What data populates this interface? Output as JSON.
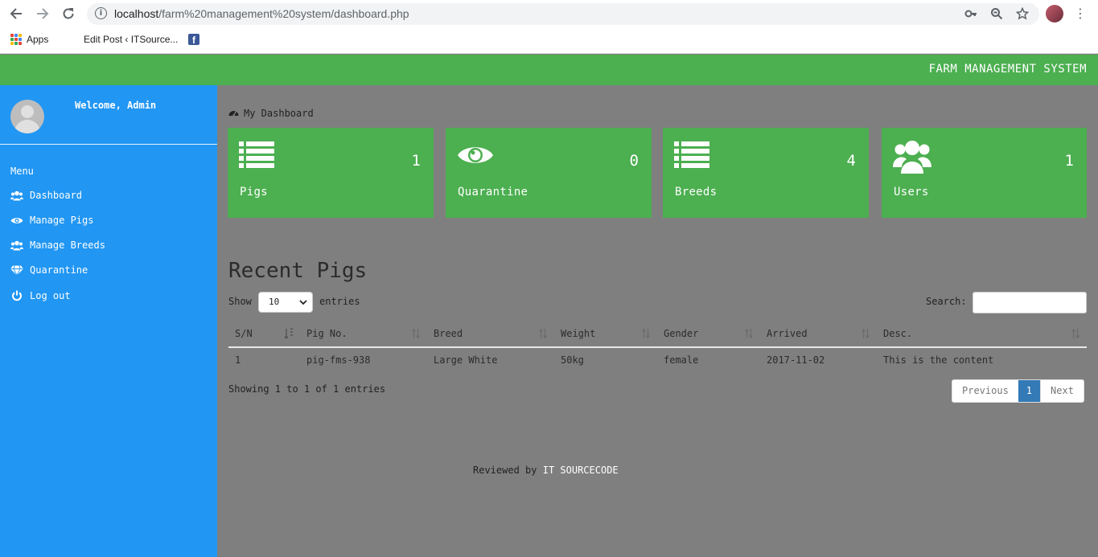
{
  "browser": {
    "url_host": "localhost",
    "url_path": "/farm%20management%20system/dashboard.php",
    "bookmarks": [
      {
        "label": "Apps",
        "icon": "apps-grid-icon"
      },
      {
        "label": "Edit Post ‹ ITSource...",
        "icon": ""
      },
      {
        "label": "",
        "icon": "facebook-icon"
      }
    ]
  },
  "app": {
    "title": "FARM MANAGEMENT SYSTEM",
    "accent": "#4caf50",
    "sidebar_color": "#2196f3"
  },
  "sidebar": {
    "welcome": "Welcome, Admin",
    "menu_heading": "Menu",
    "items": [
      {
        "label": "Dashboard",
        "icon": "users-icon"
      },
      {
        "label": "Manage Pigs",
        "icon": "eye-icon"
      },
      {
        "label": "Manage Breeds",
        "icon": "users-icon"
      },
      {
        "label": "Quarantine",
        "icon": "diamond-icon"
      },
      {
        "label": "Log out",
        "icon": "power-icon"
      }
    ]
  },
  "main": {
    "breadcrumb": "My Dashboard",
    "cards": [
      {
        "label": "Pigs",
        "count": "1",
        "icon": "list-icon"
      },
      {
        "label": "Quarantine",
        "count": "0",
        "icon": "eye-icon"
      },
      {
        "label": "Breeds",
        "count": "4",
        "icon": "list-icon"
      },
      {
        "label": "Users",
        "count": "1",
        "icon": "users-icon"
      }
    ],
    "recent_title": "Recent Pigs",
    "show_label": "Show",
    "entries_value": "10",
    "entries_label": "entries",
    "search_label": "Search:",
    "table": {
      "columns": [
        "S/N",
        "Pig No.",
        "Breed",
        "Weight",
        "Gender",
        "Arrived",
        "Desc."
      ],
      "rows": [
        [
          "1",
          "pig-fms-938",
          "Large White",
          "50kg",
          "female",
          "2017-11-02",
          "This is the content"
        ]
      ]
    },
    "info": "Showing 1 to 1 of 1 entries",
    "pager": {
      "previous": "Previous",
      "current": "1",
      "next": "Next"
    }
  },
  "footer": {
    "prefix": "Reviewed by",
    "brand": "IT SOURCECODE"
  }
}
